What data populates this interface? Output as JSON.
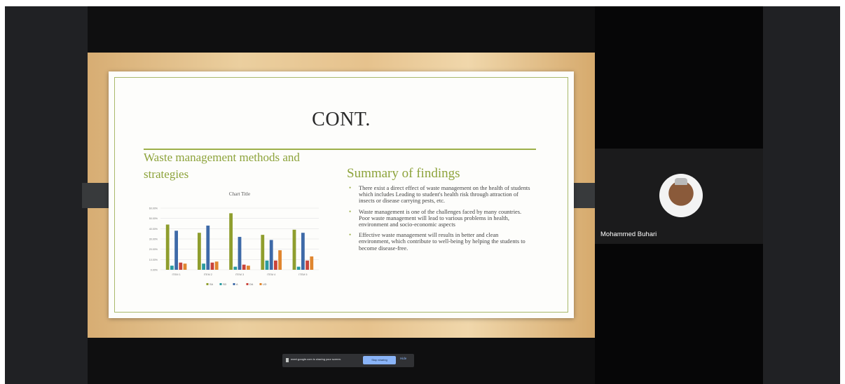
{
  "meeting": {
    "participant_name": "Mohammed Buhari",
    "share_bar": {
      "text": "meet.google.com is sharing your screen.",
      "stop_label": "Stop sharing",
      "hide_label": "Hide"
    }
  },
  "slide": {
    "title": "CONT.",
    "left_heading": "Waste management methods and strategies",
    "right_heading": "Summary of findings",
    "findings": [
      "There exist a direct effect of waste management on the health of students which includes Leading to student's health risk through attraction of insects or disease carrying pests, etc.",
      "Waste management is one of the challenges faced by many countries. Poor waste management will lead to various problems in health, environment and socio-economic aspects",
      "Effective waste management will results in better and clean environment, which contribute to well-being by helping the students to become disease-free."
    ]
  },
  "colors": {
    "SA": "#8f9e2e",
    "SD": "#2a9aa0",
    "A": "#3e6aa8",
    "DA": "#c9443b",
    "UD": "#e0862f",
    "accent": "#9db04a"
  },
  "chart_data": {
    "type": "bar",
    "title": "Chart Title",
    "categories": [
      "ITEM 1",
      "ITEM 2",
      "ITEM 3",
      "ITEM 4",
      "ITEM 5"
    ],
    "series": [
      {
        "name": "SA",
        "values": [
          44,
          36,
          55,
          34,
          39
        ]
      },
      {
        "name": "SD",
        "values": [
          4,
          6,
          3,
          9,
          3
        ]
      },
      {
        "name": "A",
        "values": [
          38,
          43,
          32,
          29,
          36
        ]
      },
      {
        "name": "DA",
        "values": [
          7,
          7,
          5,
          9,
          9
        ]
      },
      {
        "name": "UD",
        "values": [
          6,
          8,
          4,
          19,
          13
        ]
      }
    ],
    "ylim": [
      0,
      60
    ],
    "yticks": [
      "0.00%",
      "10.00%",
      "20.00%",
      "30.00%",
      "40.00%",
      "50.00%",
      "60.00%"
    ],
    "legend": "bottom",
    "grid": true
  }
}
